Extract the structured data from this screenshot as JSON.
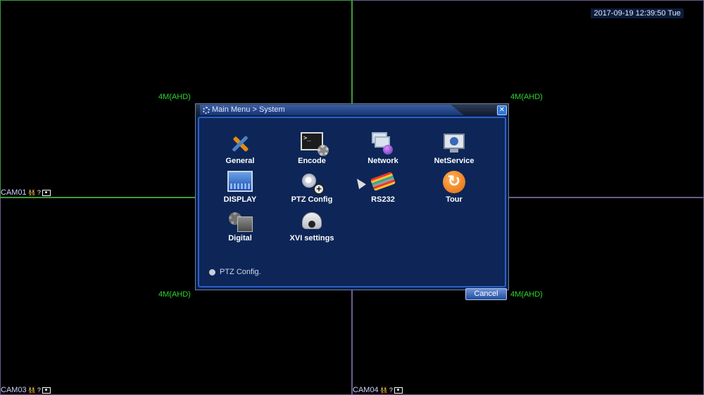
{
  "clock": "2017-09-19 12:39:50 Tue",
  "cameras": [
    {
      "name": "CAM01",
      "resolution": "4M(AHD)"
    },
    {
      "name": "",
      "resolution": "4M(AHD)"
    },
    {
      "name": "CAM03",
      "resolution": "4M(AHD)"
    },
    {
      "name": "CAM04",
      "resolution": "4M(AHD)"
    }
  ],
  "dialog": {
    "title": "Main Menu > System",
    "items": [
      {
        "label": "General",
        "icon": "tools-icon"
      },
      {
        "label": "Encode",
        "icon": "encode-terminal-icon"
      },
      {
        "label": "Network",
        "icon": "network-icon"
      },
      {
        "label": "NetService",
        "icon": "monitor-globe-icon"
      },
      {
        "label": "DISPLAY",
        "icon": "display-icon"
      },
      {
        "label": "PTZ Config",
        "icon": "ptz-camera-icon"
      },
      {
        "label": "RS232",
        "icon": "serial-cable-icon"
      },
      {
        "label": "Tour",
        "icon": "refresh-tour-icon"
      },
      {
        "label": "Digital",
        "icon": "digital-gear-icon"
      },
      {
        "label": "XVI settings",
        "icon": "dome-camera-icon"
      }
    ],
    "hint": "PTZ Config.",
    "cancel_label": "Cancel"
  }
}
